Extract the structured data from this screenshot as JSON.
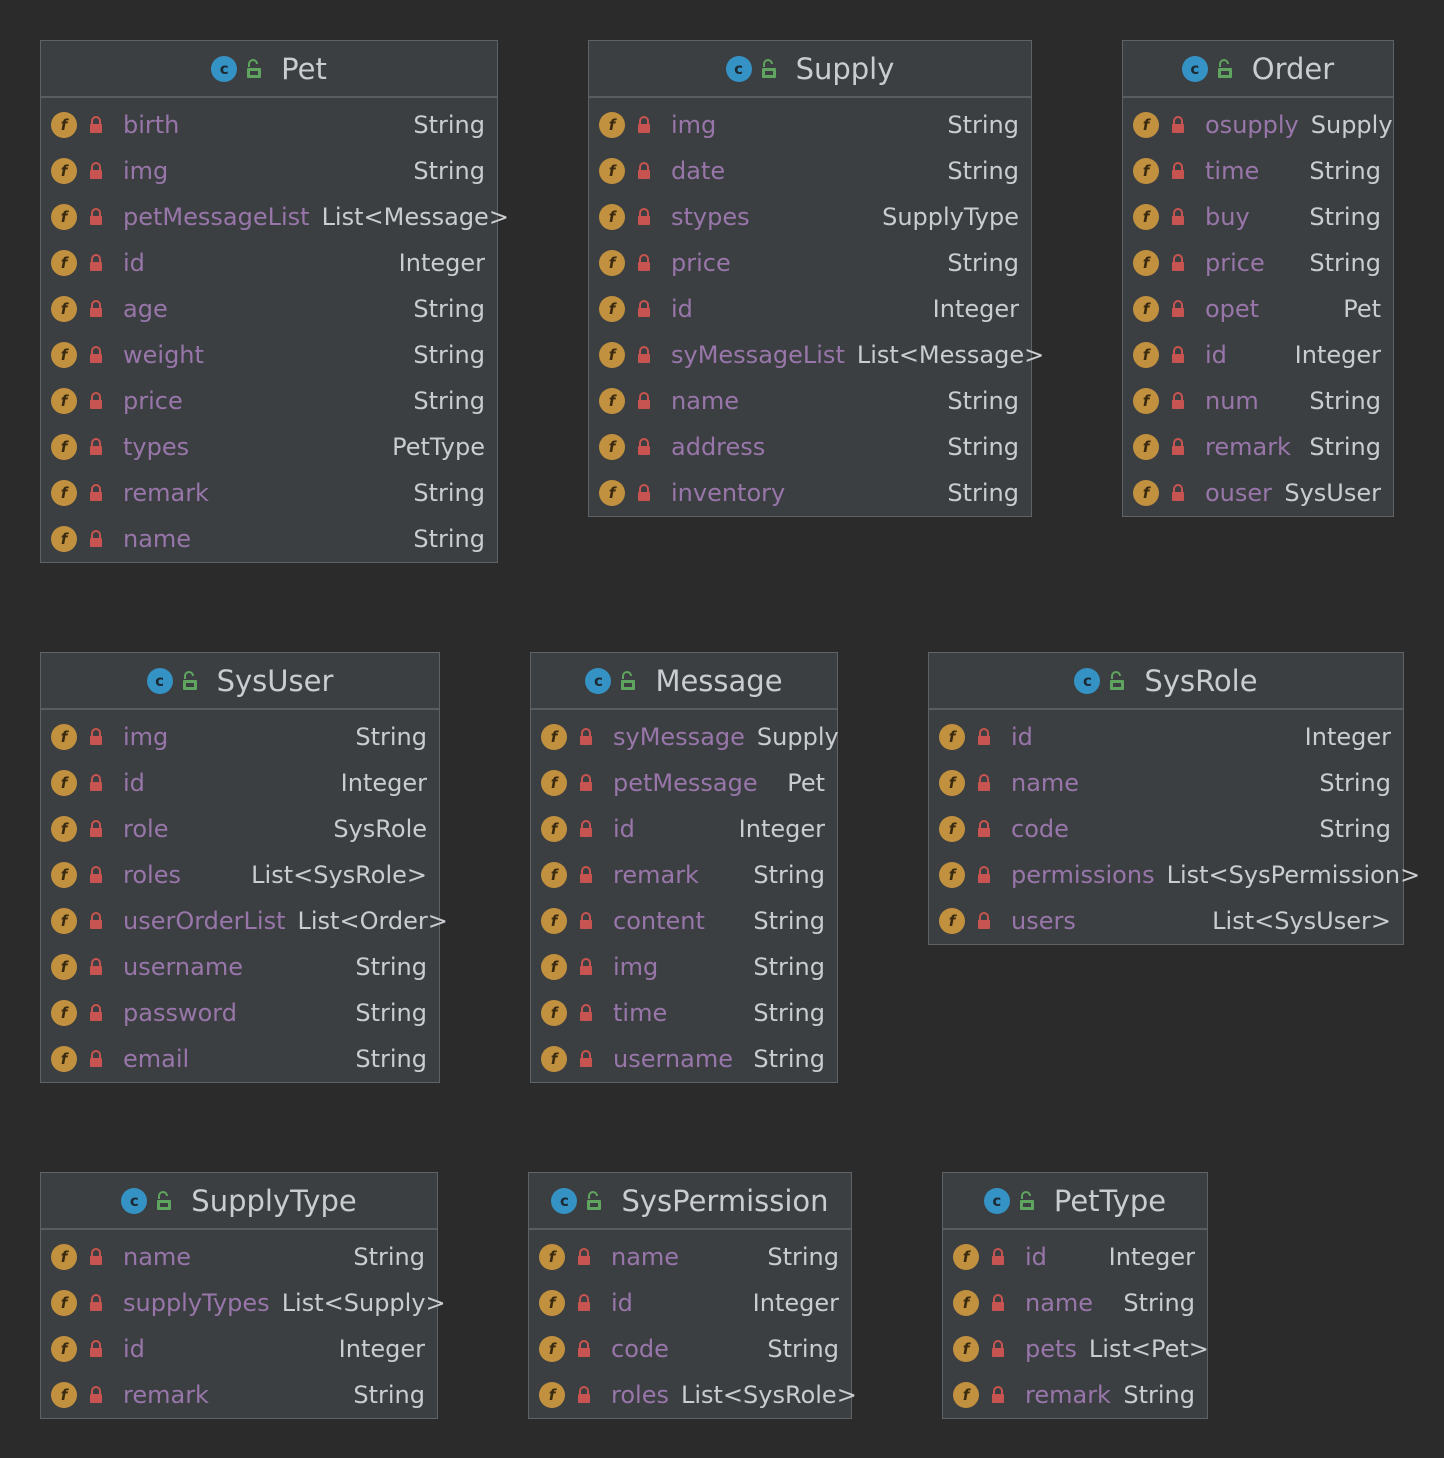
{
  "classes": [
    {
      "name": "Pet",
      "fields": [
        {
          "name": "birth",
          "type": "String"
        },
        {
          "name": "img",
          "type": "String"
        },
        {
          "name": "petMessageList",
          "type": "List<Message>"
        },
        {
          "name": "id",
          "type": "Integer"
        },
        {
          "name": "age",
          "type": "String"
        },
        {
          "name": "weight",
          "type": "String"
        },
        {
          "name": "price",
          "type": "String"
        },
        {
          "name": "types",
          "type": "PetType"
        },
        {
          "name": "remark",
          "type": "String"
        },
        {
          "name": "name",
          "type": "String"
        }
      ]
    },
    {
      "name": "Supply",
      "fields": [
        {
          "name": "img",
          "type": "String"
        },
        {
          "name": "date",
          "type": "String"
        },
        {
          "name": "stypes",
          "type": "SupplyType"
        },
        {
          "name": "price",
          "type": "String"
        },
        {
          "name": "id",
          "type": "Integer"
        },
        {
          "name": "syMessageList",
          "type": "List<Message>"
        },
        {
          "name": "name",
          "type": "String"
        },
        {
          "name": "address",
          "type": "String"
        },
        {
          "name": "inventory",
          "type": "String"
        }
      ]
    },
    {
      "name": "Order",
      "fields": [
        {
          "name": "osupply",
          "type": "Supply"
        },
        {
          "name": "time",
          "type": "String"
        },
        {
          "name": "buy",
          "type": "String"
        },
        {
          "name": "price",
          "type": "String"
        },
        {
          "name": "opet",
          "type": "Pet"
        },
        {
          "name": "id",
          "type": "Integer"
        },
        {
          "name": "num",
          "type": "String"
        },
        {
          "name": "remark",
          "type": "String"
        },
        {
          "name": "ouser",
          "type": "SysUser"
        }
      ]
    },
    {
      "name": "SysUser",
      "fields": [
        {
          "name": "img",
          "type": "String"
        },
        {
          "name": "id",
          "type": "Integer"
        },
        {
          "name": "role",
          "type": "SysRole"
        },
        {
          "name": "roles",
          "type": "List<SysRole>"
        },
        {
          "name": "userOrderList",
          "type": "List<Order>"
        },
        {
          "name": "username",
          "type": "String"
        },
        {
          "name": "password",
          "type": "String"
        },
        {
          "name": "email",
          "type": "String"
        }
      ]
    },
    {
      "name": "Message",
      "fields": [
        {
          "name": "syMessage",
          "type": "Supply"
        },
        {
          "name": "petMessage",
          "type": "Pet"
        },
        {
          "name": "id",
          "type": "Integer"
        },
        {
          "name": "remark",
          "type": "String"
        },
        {
          "name": "content",
          "type": "String"
        },
        {
          "name": "img",
          "type": "String"
        },
        {
          "name": "time",
          "type": "String"
        },
        {
          "name": "username",
          "type": "String"
        }
      ]
    },
    {
      "name": "SysRole",
      "fields": [
        {
          "name": "id",
          "type": "Integer"
        },
        {
          "name": "name",
          "type": "String"
        },
        {
          "name": "code",
          "type": "String"
        },
        {
          "name": "permissions",
          "type": "List<SysPermission>"
        },
        {
          "name": "users",
          "type": "List<SysUser>"
        }
      ]
    },
    {
      "name": "SupplyType",
      "fields": [
        {
          "name": "name",
          "type": "String"
        },
        {
          "name": "supplyTypes",
          "type": "List<Supply>"
        },
        {
          "name": "id",
          "type": "Integer"
        },
        {
          "name": "remark",
          "type": "String"
        }
      ]
    },
    {
      "name": "SysPermission",
      "fields": [
        {
          "name": "name",
          "type": "String"
        },
        {
          "name": "id",
          "type": "Integer"
        },
        {
          "name": "code",
          "type": "String"
        },
        {
          "name": "roles",
          "type": "List<SysRole>"
        }
      ]
    },
    {
      "name": "PetType",
      "fields": [
        {
          "name": "id",
          "type": "Integer"
        },
        {
          "name": "name",
          "type": "String"
        },
        {
          "name": "pets",
          "type": "List<Pet>"
        },
        {
          "name": "remark",
          "type": "String"
        }
      ]
    }
  ],
  "icons": {
    "class_icon_letter": "c",
    "field_icon_letter": "f"
  },
  "colors": {
    "background": "#2b2b2b",
    "box_fill": "#3c3f41",
    "class_icon": "#3592c4",
    "field_icon": "#c2913f",
    "lock": "#c75450",
    "public_vis": "#5fa45f",
    "field_name": "#9876aa",
    "field_type": "#c9ccd0"
  }
}
